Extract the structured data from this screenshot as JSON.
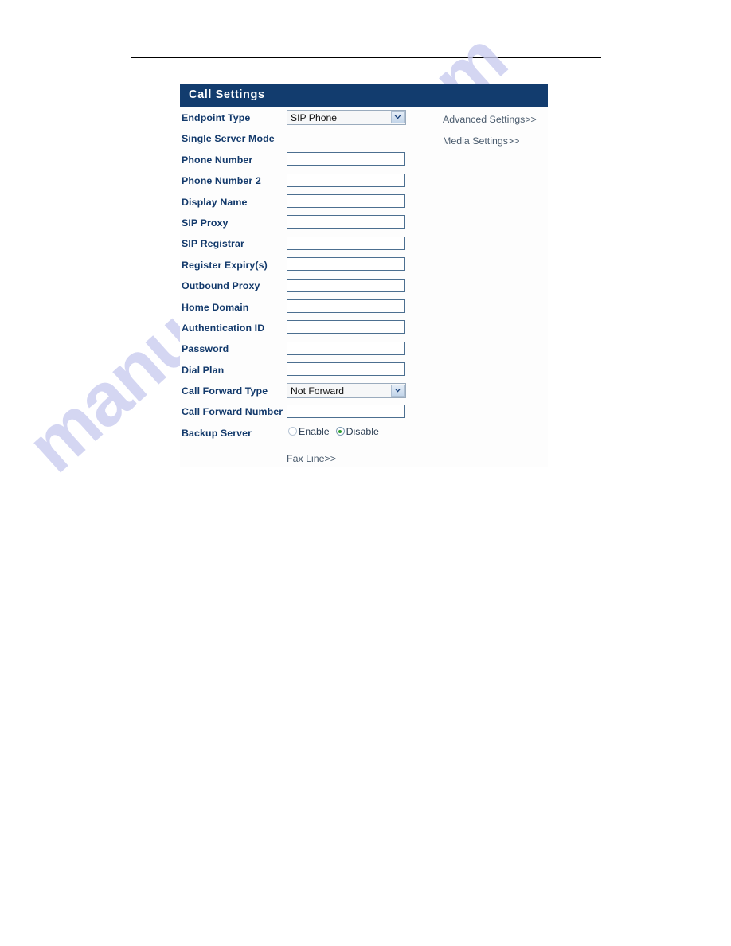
{
  "panel": {
    "title": "Call Settings"
  },
  "side_links": {
    "advanced": "Advanced Settings>>",
    "media": "Media Settings>>",
    "fax": "Fax Line>>"
  },
  "form": {
    "rows": [
      {
        "label": "Endpoint Type",
        "type": "select",
        "value": "SIP Phone"
      },
      {
        "label": "Single Server Mode",
        "type": "none",
        "value": ""
      },
      {
        "label": "Phone Number",
        "type": "text",
        "value": "",
        "placeholder": ""
      },
      {
        "label": "Phone Number 2",
        "type": "text",
        "value": "",
        "placeholder": ""
      },
      {
        "label": "Display Name",
        "type": "text",
        "value": "",
        "placeholder": ""
      },
      {
        "label": "SIP Proxy",
        "type": "text",
        "value": "",
        "placeholder": ""
      },
      {
        "label": "SIP Registrar",
        "type": "text",
        "value": "",
        "placeholder": ""
      },
      {
        "label": "Register Expiry(s)",
        "type": "text",
        "value": "",
        "placeholder": ""
      },
      {
        "label": "Outbound Proxy",
        "type": "text",
        "value": "",
        "placeholder": ""
      },
      {
        "label": "Home Domain",
        "type": "text",
        "value": "",
        "placeholder": ""
      },
      {
        "label": "Authentication ID",
        "type": "text",
        "value": "",
        "placeholder": ""
      },
      {
        "label": "Password",
        "type": "text",
        "value": "",
        "placeholder": ""
      },
      {
        "label": "Dial Plan",
        "type": "text",
        "value": "",
        "placeholder": ""
      },
      {
        "label": "Call Forward Type",
        "type": "select",
        "value": "Not Forward"
      },
      {
        "label": "Call Forward Number",
        "type": "text",
        "value": "",
        "placeholder": ""
      },
      {
        "label": "Backup Server",
        "type": "radio",
        "options": [
          {
            "label": "Enable",
            "checked": false
          },
          {
            "label": "Disable",
            "checked": true
          }
        ]
      }
    ]
  },
  "watermark": {
    "text": "manualshive.com"
  },
  "colors": {
    "title_bar": "#123c6e",
    "label_text": "#12396b",
    "input_border": "#4c6f90",
    "link_text": "#4b5c6e",
    "radio_checked": "#2f9e2f",
    "watermark": "#c9cbef"
  },
  "icons": {
    "select_arrow": "chevron-down-icon"
  }
}
